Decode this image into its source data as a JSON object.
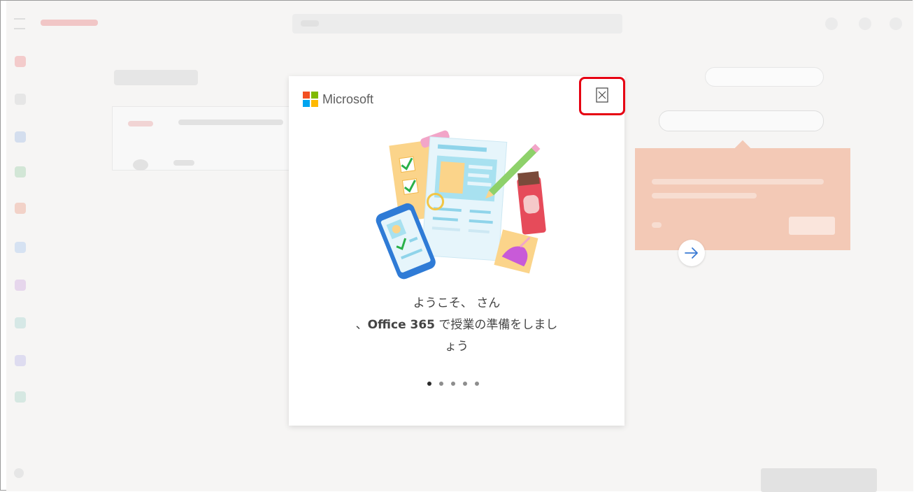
{
  "dialog": {
    "brand": "Microsoft",
    "welcome_line1": "ようこそ、 さん",
    "welcome_line2_prefix": "、",
    "welcome_line2_bold": "Office 365",
    "welcome_line2_rest": " で授業の準備をしまし",
    "welcome_line3": "ょう",
    "pages_total": 5,
    "active_page": 1,
    "close_icon": "close-icon",
    "next_icon": "arrow-right-icon"
  },
  "colors": {
    "ms_red": "#f25022",
    "ms_green": "#7fba00",
    "ms_blue": "#00a4ef",
    "ms_yellow": "#ffb900",
    "highlight": "#e60012"
  }
}
